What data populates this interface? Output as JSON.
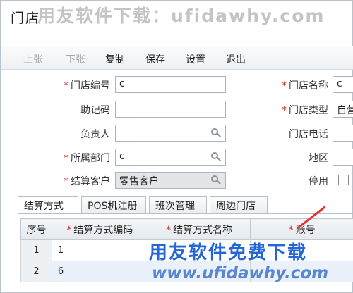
{
  "window": {
    "title": "门店"
  },
  "watermark": {
    "top_text": "用友软件下载：ufidawhy.com",
    "bottom_text": "用友软件免费下载",
    "bottom_url": "www.ufidawhy.com"
  },
  "toolbar": {
    "items": [
      {
        "label": "上张",
        "enabled": false
      },
      {
        "label": "下张",
        "enabled": false
      },
      {
        "label": "复制",
        "enabled": true
      },
      {
        "label": "保存",
        "enabled": true
      },
      {
        "label": "设置",
        "enabled": true
      },
      {
        "label": "退出",
        "enabled": true
      }
    ]
  },
  "form": {
    "store_code": {
      "label": "门店编号",
      "required": true,
      "value": "c"
    },
    "mnemonic": {
      "label": "助记码",
      "required": false,
      "value": ""
    },
    "manager": {
      "label": "负责人",
      "required": false,
      "value": ""
    },
    "department": {
      "label": "所属部门",
      "required": true,
      "value": "c"
    },
    "settle_customer": {
      "label": "结算客户",
      "required": true,
      "value": "零售客户"
    },
    "store_name": {
      "label": "门店名称",
      "required": true,
      "value": "c"
    },
    "store_type": {
      "label": "门店类型",
      "required": true,
      "value": "自营"
    },
    "store_phone": {
      "label": "门店电话",
      "required": false,
      "value": ""
    },
    "region": {
      "label": "地区",
      "required": false,
      "value": ""
    },
    "disabled": {
      "label": "停用",
      "checked": false
    }
  },
  "tabs": [
    "结算方式",
    "POS机注册",
    "班次管理",
    "周边门店"
  ],
  "grid": {
    "columns": [
      {
        "label": "序号",
        "required": false
      },
      {
        "label": "结算方式编码",
        "required": true
      },
      {
        "label": "结算方式名称",
        "required": true
      },
      {
        "label": "账号",
        "required": true
      }
    ],
    "rows": [
      {
        "idx": "1",
        "code": "1",
        "name": "",
        "account": ""
      },
      {
        "idx": "2",
        "code": "6",
        "name": "",
        "account": ""
      }
    ]
  },
  "colors": {
    "accent_blue": "#2466d6",
    "required_red": "#d9302c"
  }
}
